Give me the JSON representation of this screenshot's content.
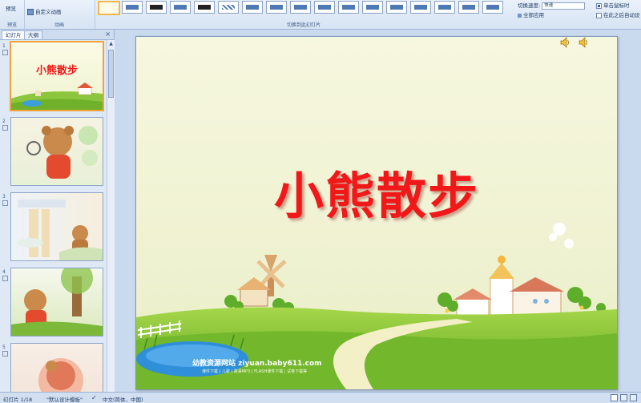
{
  "ribbon": {
    "preview_label": "预览",
    "preview_group": "预览",
    "custom_anim_label": "自定义动画",
    "anim_group": "动画",
    "transition_group": "切换到此幻灯片",
    "speed_label": "切换速度:",
    "speed_value": "快速",
    "apply_all_label": "全部应用",
    "on_click_label": "单击鼠标时",
    "auto_after_label": "在此之后自动设"
  },
  "panel": {
    "tab_slides": "幻灯片",
    "tab_outline": "大纲",
    "close": "×",
    "slides": [
      {
        "num": "1",
        "title": "小熊散步"
      },
      {
        "num": "2"
      },
      {
        "num": "3"
      },
      {
        "num": "4"
      },
      {
        "num": "5"
      }
    ]
  },
  "slide": {
    "title": "小熊散步",
    "watermark_main": "幼教资源网站  ziyuan.baby611.com",
    "watermark_sub": "课件下载 | 儿歌 | 故事MP3 | FLASH课件下载 | 试卷下载等"
  },
  "statusbar": {
    "slide_info": "幻灯片 1/18",
    "theme": "\"默认设计模板\"",
    "language": "中文(简体，中国)"
  },
  "colors": {
    "title_red": "#f01818",
    "ribbon_bg": "#d6e3f3",
    "accent_orange": "#f0a23c"
  }
}
